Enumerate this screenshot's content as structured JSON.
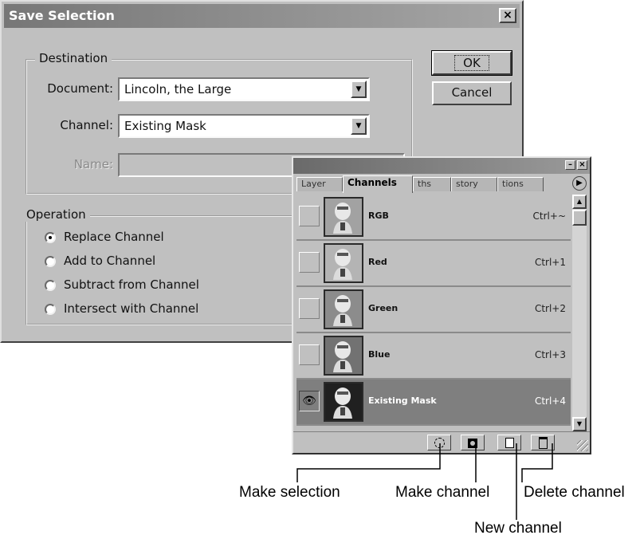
{
  "dialog": {
    "title": "Save Selection",
    "close_glyph": "×",
    "destination": {
      "legend": "Destination",
      "document_label": "Document:",
      "document_value": "Lincoln, the Large",
      "channel_label": "Channel:",
      "channel_value": "Existing Mask",
      "name_label": "Name:",
      "name_value": ""
    },
    "operation": {
      "legend": "Operation",
      "options": [
        {
          "label": "Replace Channel",
          "selected": true
        },
        {
          "label": "Add to Channel",
          "selected": false
        },
        {
          "label": "Subtract from Channel",
          "selected": false
        },
        {
          "label": "Intersect with Channel",
          "selected": false
        }
      ]
    },
    "ok_label": "OK",
    "cancel_label": "Cancel"
  },
  "palette": {
    "tabs": [
      "Layer",
      "Channels",
      "ths",
      "story",
      "tions"
    ],
    "active_tab": "Channels",
    "channels": [
      {
        "name": "RGB",
        "shortcut": "Ctrl+~",
        "visible": false,
        "selected": false,
        "tint": "#a2a2a2"
      },
      {
        "name": "Red",
        "shortcut": "Ctrl+1",
        "visible": false,
        "selected": false,
        "tint": "#b4b4b4"
      },
      {
        "name": "Green",
        "shortcut": "Ctrl+2",
        "visible": false,
        "selected": false,
        "tint": "#8c8c8c"
      },
      {
        "name": "Blue",
        "shortcut": "Ctrl+3",
        "visible": false,
        "selected": false,
        "tint": "#727272"
      },
      {
        "name": "Existing Mask",
        "shortcut": "Ctrl+4",
        "visible": true,
        "selected": true,
        "tint": "#202020"
      }
    ]
  },
  "callouts": {
    "make_selection": "Make selection",
    "make_channel": "Make channel",
    "delete_channel": "Delete channel",
    "new_channel": "New channel"
  }
}
